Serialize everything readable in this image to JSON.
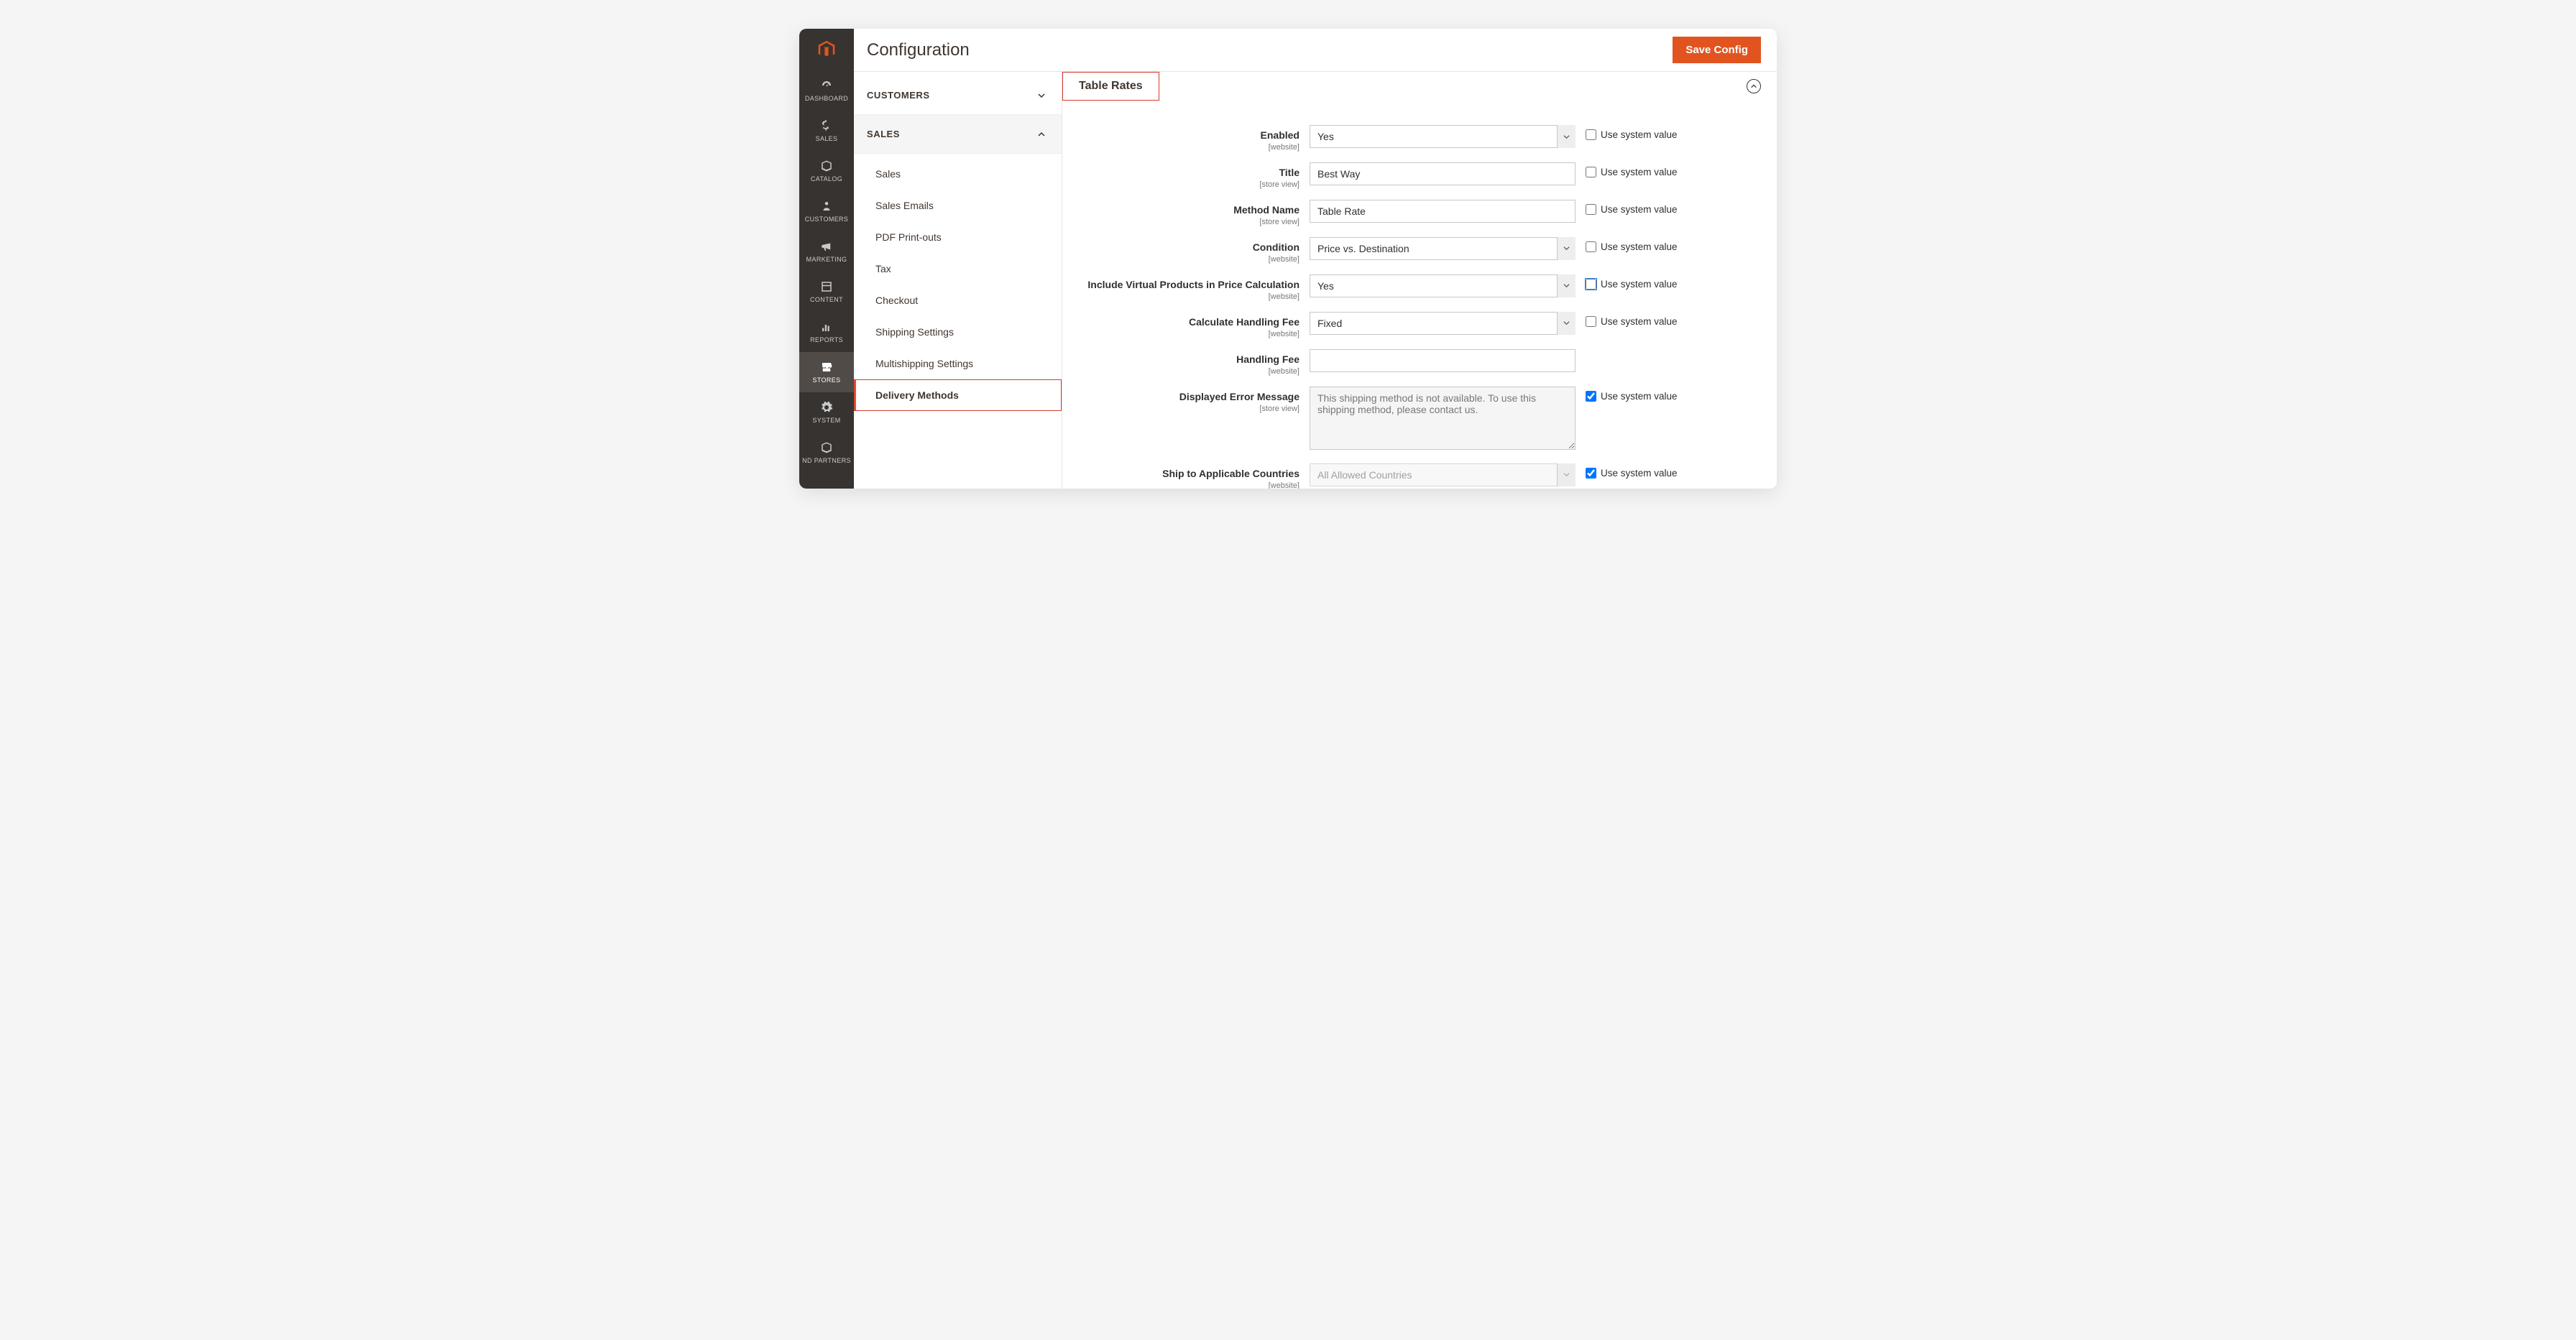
{
  "header": {
    "title": "Configuration",
    "save_button": "Save Config"
  },
  "rail": [
    {
      "key": "dashboard",
      "label": "DASHBOARD"
    },
    {
      "key": "sales",
      "label": "SALES"
    },
    {
      "key": "catalog",
      "label": "CATALOG"
    },
    {
      "key": "customers",
      "label": "CUSTOMERS"
    },
    {
      "key": "marketing",
      "label": "MARKETING"
    },
    {
      "key": "content",
      "label": "CONTENT"
    },
    {
      "key": "reports",
      "label": "REPORTS"
    },
    {
      "key": "stores",
      "label": "STORES"
    },
    {
      "key": "system",
      "label": "SYSTEM"
    },
    {
      "key": "partners",
      "label": "ND PARTNERS"
    }
  ],
  "secnav": {
    "group_customers": "CUSTOMERS",
    "group_sales": "SALES",
    "sales_items": [
      "Sales",
      "Sales Emails",
      "PDF Print-outs",
      "Tax",
      "Checkout",
      "Shipping Settings",
      "Multishipping Settings",
      "Delivery Methods"
    ]
  },
  "section_title": "Table Rates",
  "use_system_label": "Use system value",
  "fields": {
    "enabled": {
      "label": "Enabled",
      "scope": "[website]",
      "value": "Yes",
      "type": "select",
      "use_system": false
    },
    "title": {
      "label": "Title",
      "scope": "[store view]",
      "value": "Best Way",
      "type": "text",
      "use_system": false
    },
    "method_name": {
      "label": "Method Name",
      "scope": "[store view]",
      "value": "Table Rate",
      "type": "text",
      "use_system": false
    },
    "condition": {
      "label": "Condition",
      "scope": "[website]",
      "value": "Price vs. Destination",
      "type": "select",
      "use_system": false
    },
    "include_virtual": {
      "label": "Include Virtual Products in Price Calculation",
      "scope": "[website]",
      "value": "Yes",
      "type": "select",
      "use_system": false,
      "blue": true
    },
    "calc_handling": {
      "label": "Calculate Handling Fee",
      "scope": "[website]",
      "value": "Fixed",
      "type": "select",
      "use_system": false
    },
    "handling_fee": {
      "label": "Handling Fee",
      "scope": "[website]",
      "value": "",
      "type": "text",
      "no_system": true
    },
    "error_msg": {
      "label": "Displayed Error Message",
      "scope": "[store view]",
      "value": "This shipping method is not available. To use this shipping method, please contact us.",
      "type": "textarea",
      "use_system": true
    },
    "ship_countries": {
      "label": "Ship to Applicable Countries",
      "scope": "[website]",
      "value": "All Allowed Countries",
      "type": "select",
      "use_system": true
    }
  }
}
